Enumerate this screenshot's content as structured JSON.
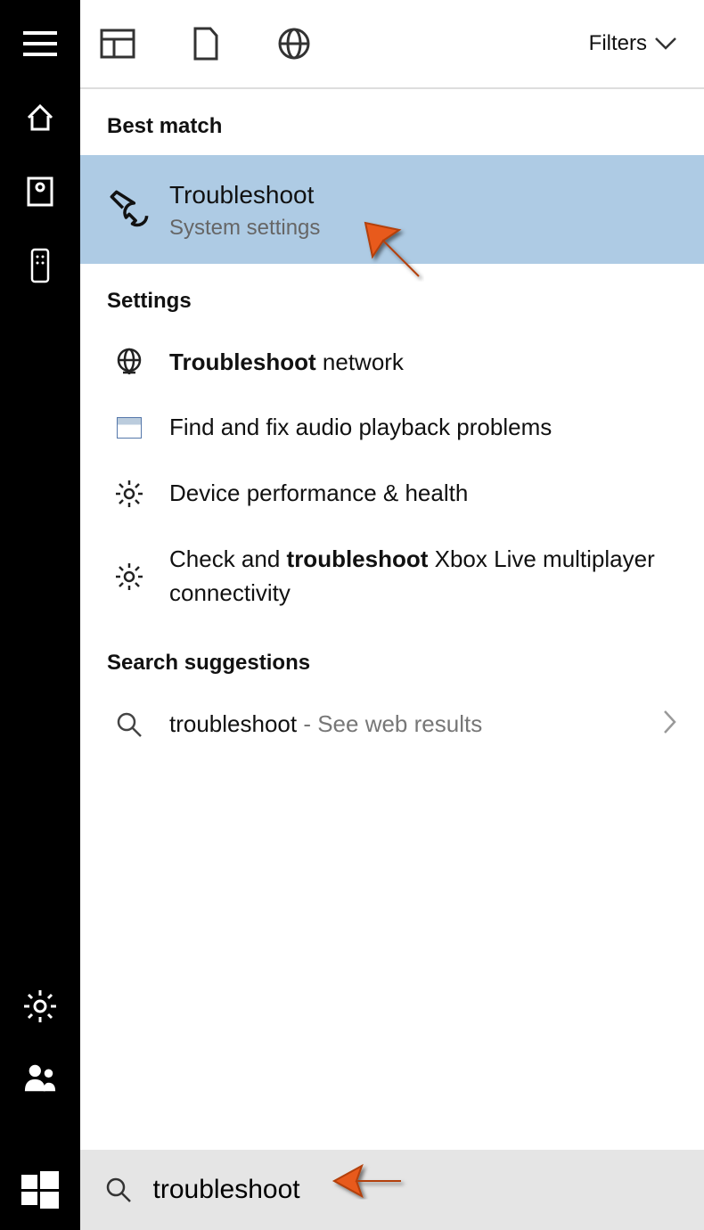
{
  "sidebar": {
    "icons": [
      "hamburger",
      "home",
      "reader",
      "remote"
    ],
    "bottom": [
      "settings",
      "people",
      "start"
    ]
  },
  "topbar": {
    "tabs": [
      "apps",
      "documents",
      "web"
    ],
    "filters_label": "Filters"
  },
  "sections": {
    "best_label": "Best match",
    "settings_label": "Settings",
    "suggestions_label": "Search suggestions"
  },
  "best_match": {
    "title": "Troubleshoot",
    "subtitle": "System settings"
  },
  "settings_items": [
    {
      "prefix_bold": "Troubleshoot",
      "rest": " network",
      "icon": "globe"
    },
    {
      "prefix_bold": "",
      "rest": "Find and fix audio playback problems",
      "icon": "audio"
    },
    {
      "prefix_bold": "",
      "rest": "Device performance & health",
      "icon": "gear"
    },
    {
      "before": "Check and ",
      "prefix_bold": "troubleshoot",
      "rest": " Xbox Live multiplayer connectivity",
      "icon": "gear"
    }
  ],
  "suggestion": {
    "query": "troubleshoot",
    "hint": " - See web results"
  },
  "search": {
    "placeholder": "",
    "value": "troubleshoot"
  }
}
